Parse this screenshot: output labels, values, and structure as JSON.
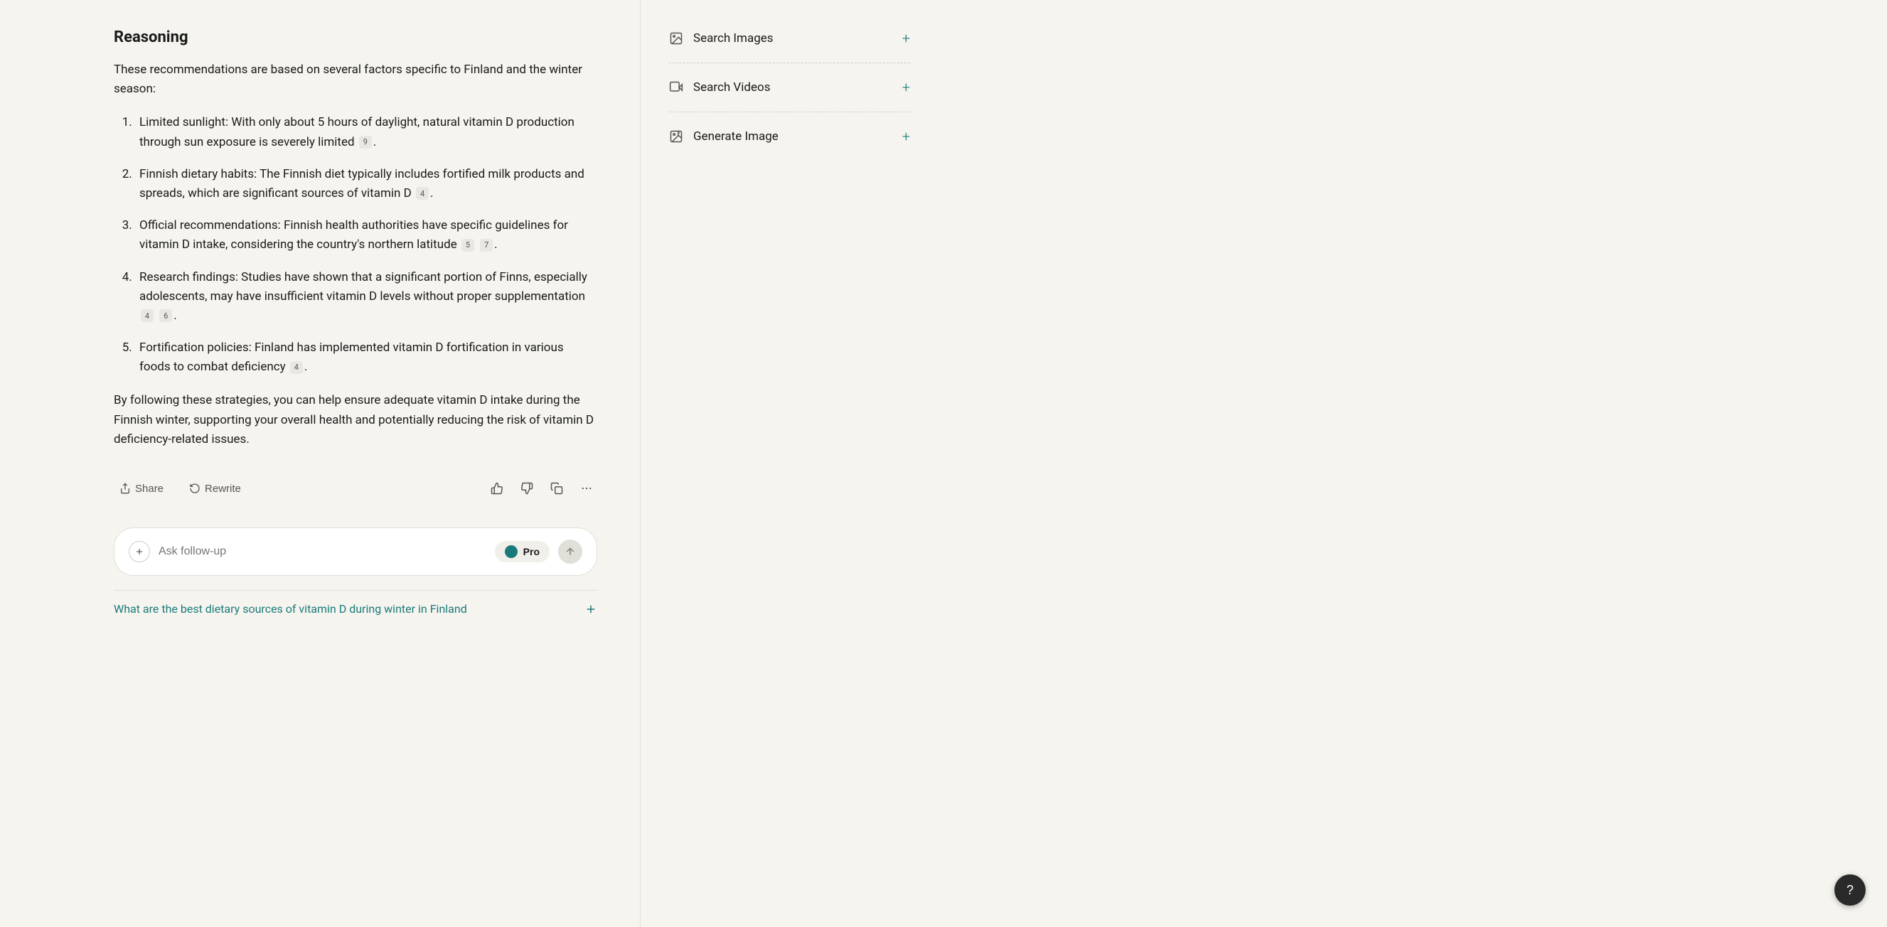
{
  "main": {
    "reasoning_title": "Reasoning",
    "reasoning_intro": "These recommendations are based on several factors specific to Finland and the winter season:",
    "list_items": [
      {
        "text": "Limited sunlight: With only about 5 hours of daylight, natural vitamin D production through sun exposure is severely limited",
        "citations": [
          "9"
        ]
      },
      {
        "text": "Finnish dietary habits: The Finnish diet typically includes fortified milk products and spreads, which are significant sources of vitamin D",
        "citations": [
          "4"
        ]
      },
      {
        "text": "Official recommendations: Finnish health authorities have specific guidelines for vitamin D intake, considering the country's northern latitude",
        "citations": [
          "5",
          "7"
        ]
      },
      {
        "text": "Research findings: Studies have shown that a significant portion of Finns, especially adolescents, may have insufficient vitamin D levels without proper supplementation",
        "citations": [
          "4",
          "6"
        ]
      },
      {
        "text": "Fortification policies: Finland has implemented vitamin D fortification in various foods to combat deficiency",
        "citations": [
          "4"
        ]
      }
    ],
    "conclusion": "By following these strategies, you can help ensure adequate vitamin D intake during the Finnish winter, supporting your overall health and potentially reducing the risk of vitamin D deficiency-related issues.",
    "share_label": "Share",
    "rewrite_label": "Rewrite",
    "follow_up_placeholder": "Ask follow-up",
    "pro_label": "Pro",
    "related_question": "What are the best dietary sources of vitamin D during winter in Finland"
  },
  "sidebar": {
    "items": [
      {
        "id": "search-images",
        "label": "Search Images",
        "icon": "image-icon"
      },
      {
        "id": "search-videos",
        "label": "Search Videos",
        "icon": "video-icon"
      },
      {
        "id": "generate-image",
        "label": "Generate Image",
        "icon": "generate-icon"
      }
    ]
  },
  "help": {
    "label": "?"
  }
}
